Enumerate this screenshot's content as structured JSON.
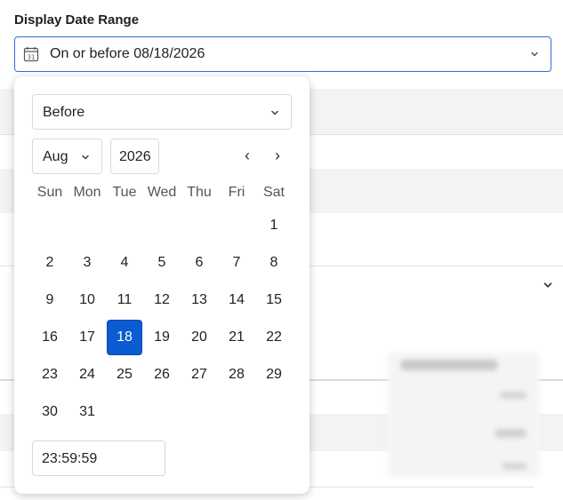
{
  "filter": {
    "label": "Display Date Range",
    "value": "On or before 08/18/2026",
    "calendar_icon_text": "31",
    "accent_color": "#2f6fd8"
  },
  "picker": {
    "mode": "Before",
    "month": "Aug",
    "year": "2026",
    "prev_label": "‹",
    "next_label": "›",
    "weekdays": [
      "Sun",
      "Mon",
      "Tue",
      "Wed",
      "Thu",
      "Fri",
      "Sat"
    ],
    "first_weekday_index": 6,
    "days_in_month": 31,
    "selected_day": 18,
    "selected_color": "#0b5bd3",
    "time": "23:59:59"
  }
}
